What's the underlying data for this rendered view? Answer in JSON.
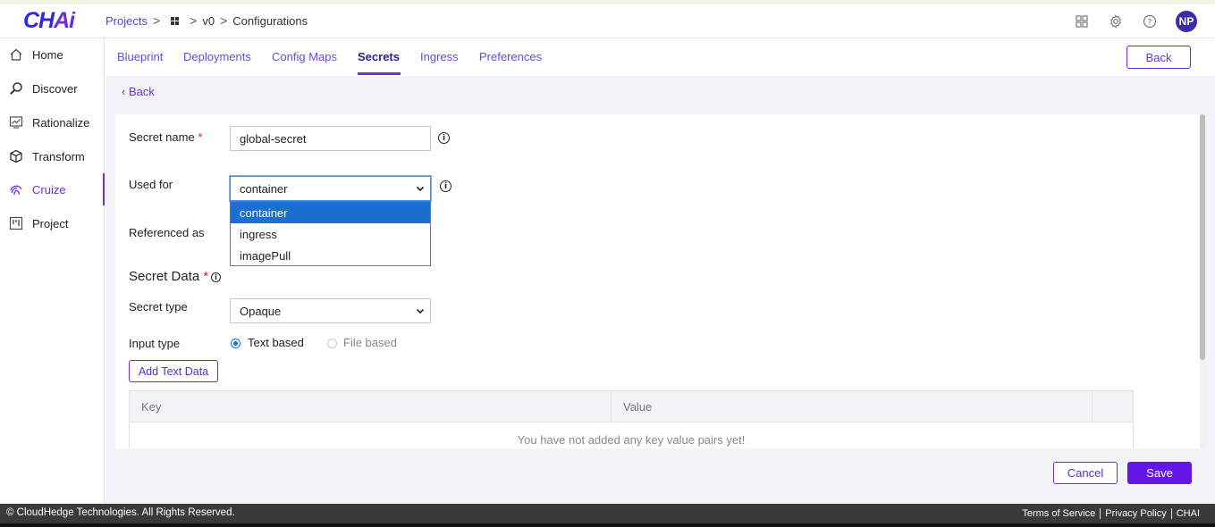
{
  "header": {
    "logo": "CHAi",
    "breadcrumbs": {
      "projects": "Projects",
      "version": "v0",
      "current": "Configurations"
    },
    "avatar": "NP",
    "icons": [
      "apps-icon",
      "gear-icon",
      "help-icon"
    ]
  },
  "sidebar": {
    "items": [
      {
        "label": "Home",
        "icon": "home-icon"
      },
      {
        "label": "Discover",
        "icon": "search-icon"
      },
      {
        "label": "Rationalize",
        "icon": "chart-icon"
      },
      {
        "label": "Transform",
        "icon": "cube-icon"
      },
      {
        "label": "Cruize",
        "icon": "fingerprint-icon",
        "active": true
      },
      {
        "label": "Project",
        "icon": "board-icon"
      }
    ]
  },
  "tabs": [
    "Blueprint",
    "Deployments",
    "Config Maps",
    "Secrets",
    "Ingress",
    "Preferences"
  ],
  "active_tab": "Secrets",
  "top_back": "Back",
  "back_link": "Back",
  "form": {
    "secret_name_label": "Secret name",
    "required_mark": "*",
    "secret_name_value": "global-secret",
    "used_for_label": "Used for",
    "used_for_value": "container",
    "used_for_options": [
      "container",
      "ingress",
      "imagePull"
    ],
    "referenced_as_label": "Referenced as",
    "secret_data_heading": "Secret Data",
    "secret_type_label": "Secret type",
    "secret_type_value": "Opaque",
    "input_type_label": "Input type",
    "input_text_based": "Text based",
    "input_file_based": "File based",
    "add_text_data": "Add Text Data"
  },
  "table": {
    "columns": [
      "Key",
      "Value"
    ],
    "empty_message": "You have not added any key value pairs yet!"
  },
  "actions": {
    "cancel": "Cancel",
    "save": "Save"
  },
  "footer": {
    "copyright": "© CloudHedge Technologies. All Rights Reserved.",
    "links": [
      "Terms of Service",
      "Privacy Policy",
      "CHAI"
    ]
  },
  "colors": {
    "accent": "#6b2fd8",
    "primary_button": "#6316e6",
    "selected_option": "#1a6fd1"
  }
}
